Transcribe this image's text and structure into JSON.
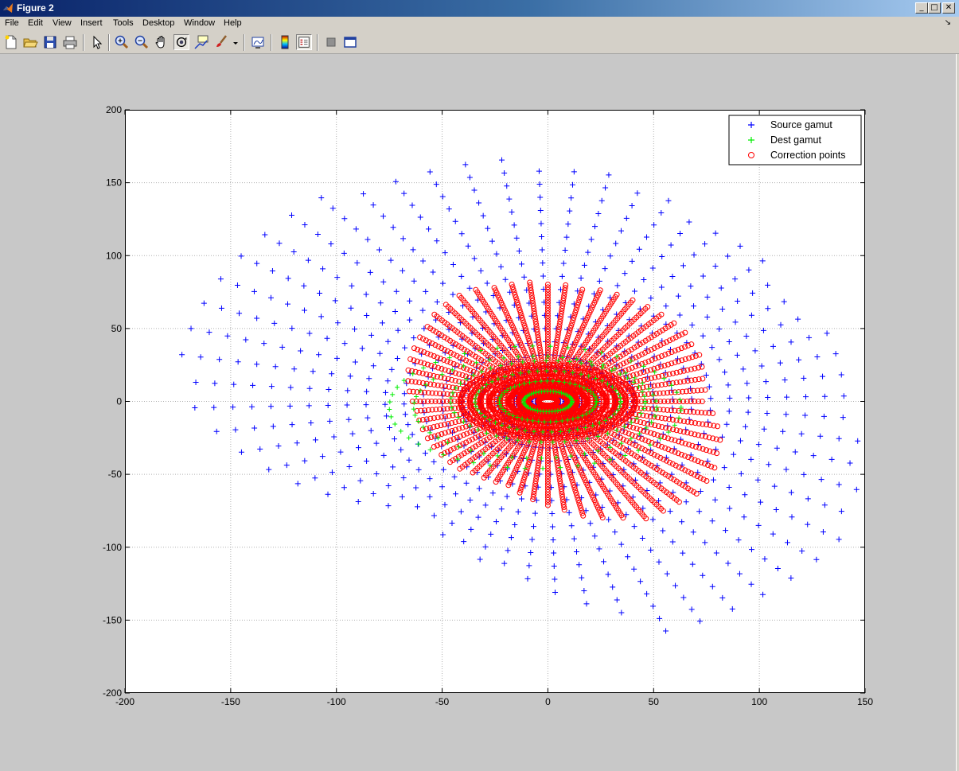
{
  "window": {
    "title": "Figure 2",
    "controls": [
      "_",
      "□",
      "✕"
    ]
  },
  "menu": [
    "File",
    "Edit",
    "View",
    "Insert",
    "Tools",
    "Desktop",
    "Window",
    "Help"
  ],
  "toolbar": [
    "new-figure",
    "open-file",
    "save",
    "print",
    "edit-plot",
    "zoom-in",
    "zoom-out",
    "pan",
    "rotate-3d",
    "data-cursor",
    "brush",
    "brush-menu",
    "link-plot",
    "insert-colorbar",
    "insert-legend",
    "hide-plot-tools",
    "show-plot-tools"
  ],
  "colors": {
    "source": "#0000ff",
    "dest": "#00ee00",
    "correction": "#ff0000",
    "figure_bg": "#c8c8c8"
  },
  "chart_data": {
    "type": "scatter",
    "xlim": [
      -200,
      150
    ],
    "ylim": [
      -200,
      200
    ],
    "xticks": [
      "-200",
      "-150",
      "-100",
      "-50",
      "0",
      "50",
      "100",
      "150"
    ],
    "yticks": [
      "200",
      "150",
      "100",
      "50",
      "0",
      "-50",
      "-100",
      "-150",
      "-200"
    ],
    "grid": true,
    "legend_position": "top-right",
    "series": [
      {
        "name": "Source gamut",
        "marker": "+",
        "color": "#0000ff",
        "description": "radial grid of points, 60 rays, radii 5..165 step 9 within gamut boundary"
      },
      {
        "name": "Dest gamut",
        "marker": "+",
        "color": "#00ee00",
        "description": "concentric ellipses, a/b = 1.7, semi-axes up to ~72 x 42"
      },
      {
        "name": "Correction points",
        "marker": "o",
        "color": "#ff0000",
        "description": "dense circles along 60 rays, radius 10..85, ellipse core up to ~42 x 25"
      }
    ],
    "source_boundary": [
      {
        "angle": 0,
        "radius": 144
      },
      {
        "angle": 30,
        "radius": 138
      },
      {
        "angle": 60,
        "radius": 144
      },
      {
        "angle": 90,
        "radius": 166
      },
      {
        "angle": 120,
        "radius": 175
      },
      {
        "angle": 150,
        "radius": 185
      },
      {
        "angle": 180,
        "radius": 172
      },
      {
        "angle": 200,
        "radius": 142
      },
      {
        "angle": 230,
        "radius": 99
      },
      {
        "angle": 260,
        "radius": 118
      },
      {
        "angle": 290,
        "radius": 168
      },
      {
        "angle": 320,
        "radius": 176
      },
      {
        "angle": 345,
        "radius": 155
      },
      {
        "angle": 360,
        "radius": 144
      }
    ],
    "correction_boundary": [
      {
        "angle": 0,
        "radius": 74
      },
      {
        "angle": 40,
        "radius": 82
      },
      {
        "angle": 80,
        "radius": 80
      },
      {
        "angle": 120,
        "radius": 85
      },
      {
        "angle": 150,
        "radius": 73
      },
      {
        "angle": 180,
        "radius": 64
      },
      {
        "angle": 220,
        "radius": 63
      },
      {
        "angle": 250,
        "radius": 60
      },
      {
        "angle": 280,
        "radius": 79
      },
      {
        "angle": 300,
        "radius": 93
      },
      {
        "angle": 320,
        "radius": 95
      },
      {
        "angle": 345,
        "radius": 85
      },
      {
        "angle": 360,
        "radius": 74
      }
    ]
  }
}
